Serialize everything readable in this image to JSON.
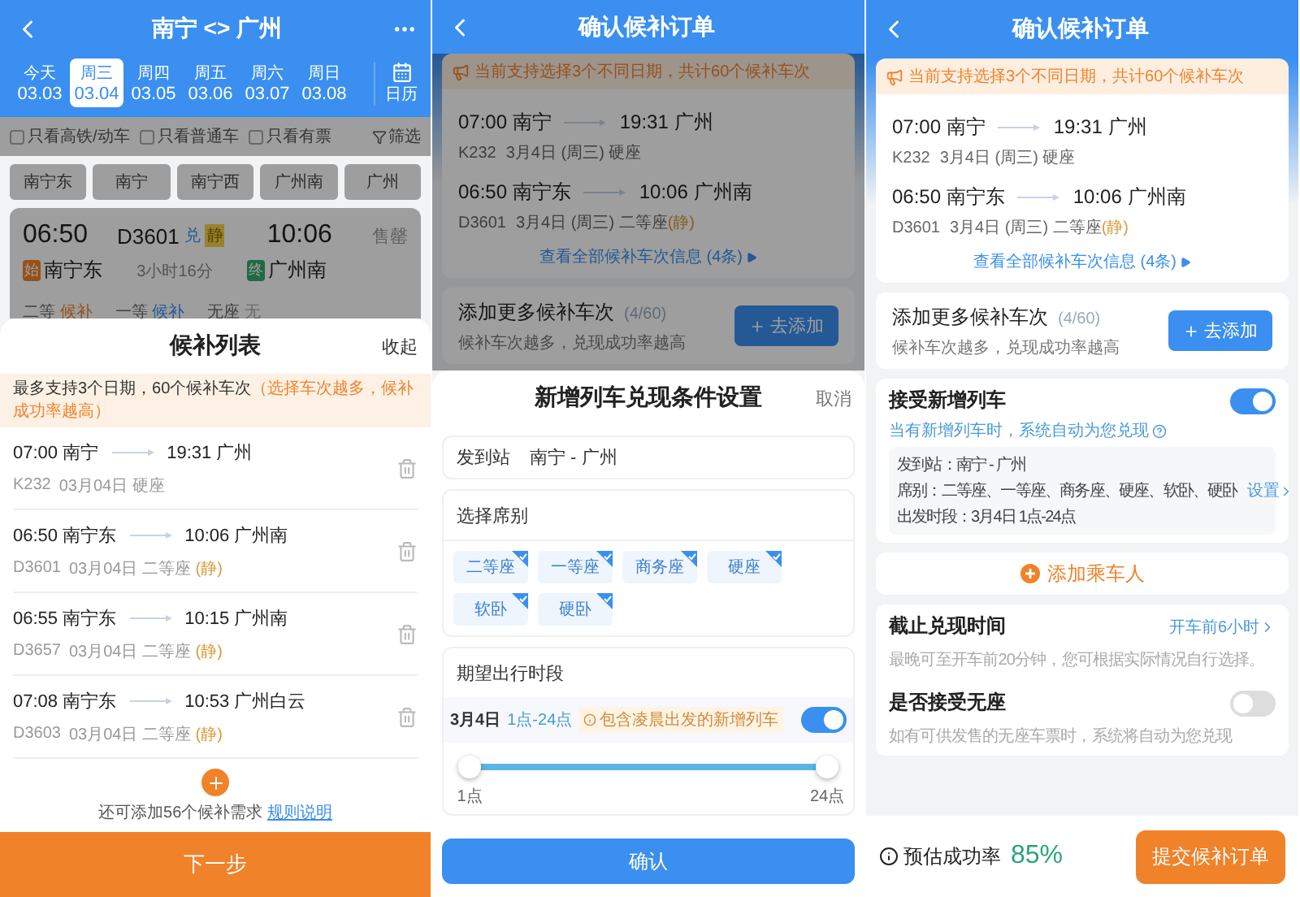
{
  "list_screen": {
    "header": {
      "title": "南宁 <> 广州"
    },
    "dates": [
      {
        "weekday": "今天",
        "date": "03.03",
        "selected": false
      },
      {
        "weekday": "周三",
        "date": "03.04",
        "selected": true
      },
      {
        "weekday": "周四",
        "date": "03.05",
        "selected": false
      },
      {
        "weekday": "周五",
        "date": "03.06",
        "selected": false
      },
      {
        "weekday": "周六",
        "date": "03.07",
        "selected": false
      },
      {
        "weekday": "周日",
        "date": "03.08",
        "selected": false
      }
    ],
    "calendar_label": "日历",
    "filters": [
      {
        "label": "只看高铁/动车",
        "checked": false
      },
      {
        "label": "只看普通车",
        "checked": false
      },
      {
        "label": "只看有票",
        "checked": false
      }
    ],
    "filter_button": "筛选",
    "stations": [
      "南宁东",
      "南宁",
      "南宁西",
      "广州南",
      "广州"
    ],
    "train": {
      "depart_time": "06:50",
      "code": "D3601",
      "badges": [
        "兑",
        "静"
      ],
      "arrive_time": "10:06",
      "status": "售罄",
      "from_mark": "始",
      "from": "南宁东",
      "duration": "3小时16分",
      "to_mark": "终",
      "to": "广州南",
      "seats": [
        {
          "class": "二等",
          "status": "候补"
        },
        {
          "class": "一等",
          "status": "候补"
        },
        {
          "class": "无座",
          "status": "无"
        }
      ]
    },
    "sheet": {
      "title": "候补列表",
      "close": "收起",
      "notice": "最多支持3个日期，60个候补车次",
      "notice_hint": "（选择车次越多，候补成功率越高）",
      "items": [
        {
          "depart_time": "07:00",
          "from": "南宁",
          "arrive_time": "19:31",
          "to": "广州",
          "code": "K232",
          "date": "03月04日",
          "seat": "硬座"
        },
        {
          "depart_time": "06:50",
          "from": "南宁东",
          "arrive_time": "10:06",
          "to": "广州南",
          "code": "D3601",
          "date": "03月04日",
          "seat": "二等座",
          "quiet": "(静)"
        },
        {
          "depart_time": "06:55",
          "from": "南宁东",
          "arrive_time": "10:15",
          "to": "广州南",
          "code": "D3657",
          "date": "03月04日",
          "seat": "二等座",
          "quiet": "(静)"
        },
        {
          "depart_time": "07:08",
          "from": "南宁东",
          "arrive_time": "10:53",
          "to": "广州白云",
          "code": "D3603",
          "date": "03月04日",
          "seat": "二等座",
          "quiet": "(静)"
        }
      ],
      "footer": "还可添加56个候补需求",
      "rules_link": "规则说明",
      "next": "下一步"
    }
  },
  "condition_screen": {
    "header": {
      "title": "确认候补订单"
    },
    "order": {
      "notice": "当前支持选择3个不同日期，共计60个候补车次",
      "trains": [
        {
          "depart_time": "07:00",
          "from": "南宁",
          "arrive_time": "19:31",
          "to": "广州",
          "code": "K232",
          "date": "3月4日 (周三)",
          "seat": "硬座"
        },
        {
          "depart_time": "06:50",
          "from": "南宁东",
          "arrive_time": "10:06",
          "to": "广州南",
          "code": "D3601",
          "date": "3月4日 (周三)",
          "seat": "二等座",
          "quiet": "(静)"
        }
      ],
      "view_all": "查看全部候补车次信息 (4条)",
      "add_more": {
        "title": "添加更多候补车次",
        "count": "(4/60)",
        "subtitle": "候补车次越多，兑现成功率越高",
        "button": "去添加"
      }
    },
    "sheet": {
      "title": "新增列车兑现条件设置",
      "cancel": "取消",
      "station_label": "发到站",
      "station_value": "南宁 - 广州",
      "seat_title": "选择席别",
      "seats": [
        {
          "label": "二等座",
          "checked": true
        },
        {
          "label": "一等座",
          "checked": true
        },
        {
          "label": "商务座",
          "checked": true
        },
        {
          "label": "硬座",
          "checked": true
        },
        {
          "label": "软卧",
          "checked": true
        },
        {
          "label": "硬卧",
          "checked": true
        }
      ],
      "period_title": "期望出行时段",
      "period": {
        "date": "3月4日",
        "range": "1点-24点",
        "hint": "包含凌晨出发的新增列车",
        "on": true,
        "level": 1,
        "min_label": "1点",
        "max_label": "24点"
      },
      "confirm": "确认"
    }
  },
  "order_screen": {
    "header": {
      "title": "确认候补订单"
    },
    "order": {
      "notice": "当前支持选择3个不同日期，共计60个候补车次",
      "trains": [
        {
          "depart_time": "07:00",
          "from": "南宁",
          "arrive_time": "19:31",
          "to": "广州",
          "code": "K232",
          "date": "3月4日 (周三)",
          "seat": "硬座"
        },
        {
          "depart_time": "06:50",
          "from": "南宁东",
          "arrive_time": "10:06",
          "to": "广州南",
          "code": "D3601",
          "date": "3月4日 (周三)",
          "seat": "二等座",
          "quiet": "(静)"
        }
      ],
      "view_all": "查看全部候补车次信息 (4条)",
      "add_more": {
        "title": "添加更多候补车次",
        "count": "(4/60)",
        "subtitle": "候补车次越多，兑现成功率越高",
        "button": "去添加"
      }
    },
    "accept_new": {
      "title": "接受新增列车",
      "subtitle": "当有新增列车时，系统自动为您兑现",
      "on": true,
      "info": [
        {
          "label": "发到站：",
          "value": "南宁 - 广州"
        },
        {
          "label": "席别：",
          "value": "二等座、一等座、商务座、硬座、软卧、硬卧"
        },
        {
          "label": "出发时段：",
          "value": "3月4日 1点-24点"
        }
      ],
      "settings_link": "设置"
    },
    "add_passenger": "添加乘车人",
    "deadline": {
      "title": "截止兑现时间",
      "value": "开车前6小时",
      "desc": "最晚可至开车前20分钟，您可根据实际情况自行选择。"
    },
    "no_seat": {
      "title": "是否接受无座",
      "on": false,
      "desc": "如有可供发售的无座车票时，系统将自动为您兑现"
    },
    "footer": {
      "label": "预估成功率",
      "value": "85%",
      "submit": "提交候补订单"
    }
  }
}
